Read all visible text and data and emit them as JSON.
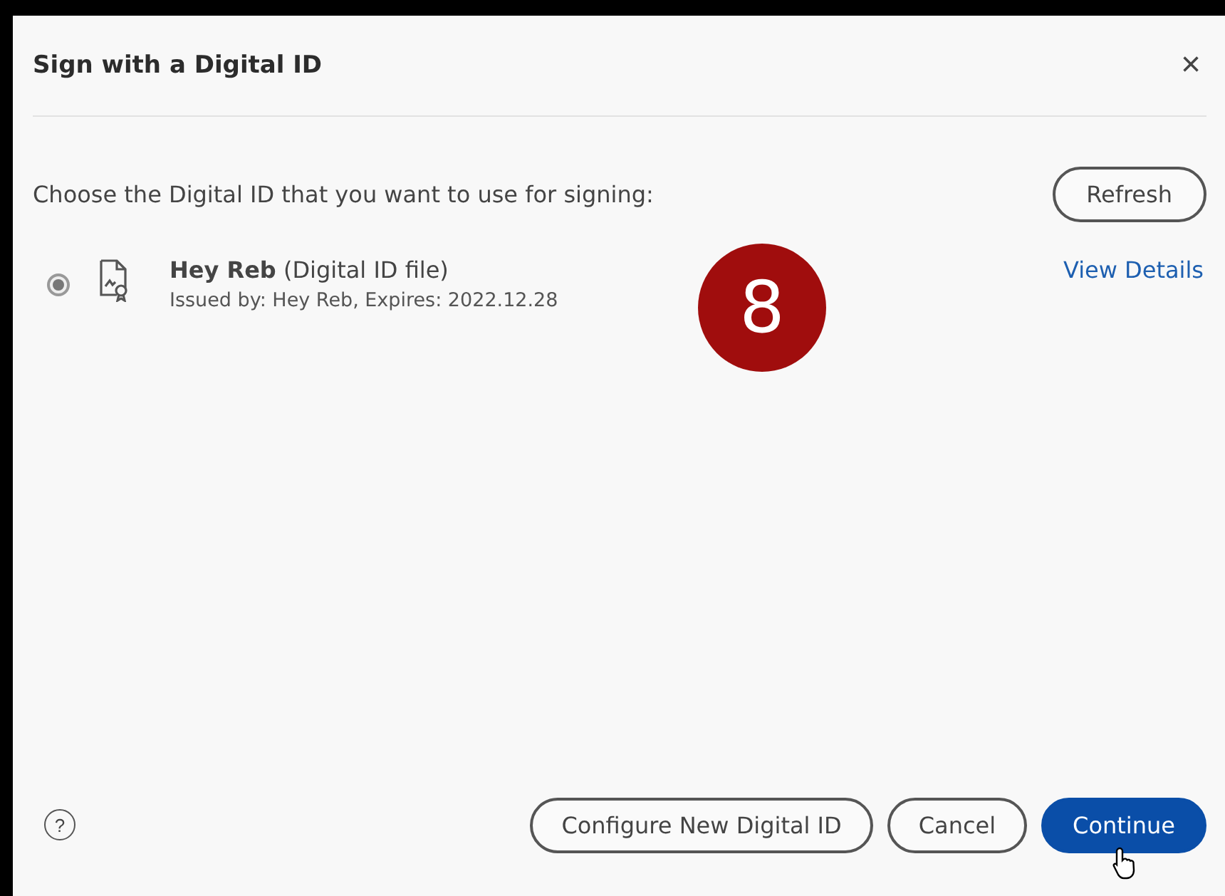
{
  "dialog": {
    "title": "Sign with a Digital ID",
    "close": "×"
  },
  "prompt": "Choose the Digital ID that you want to use for signing:",
  "refresh_button": "Refresh",
  "ids": [
    {
      "name": "Hey Reb",
      "type": "(Digital ID file)",
      "issued": "Issued by: Hey Reb, Expires: 2022.12.28",
      "details_link": "View Details",
      "selected": true
    }
  ],
  "step_badge": "8",
  "footer": {
    "help": "?",
    "buttons": [
      {
        "label": "Configure New Digital ID",
        "kind": "secondary"
      },
      {
        "label": "Cancel",
        "kind": "secondary"
      },
      {
        "label": "Continue",
        "kind": "primary"
      }
    ]
  }
}
